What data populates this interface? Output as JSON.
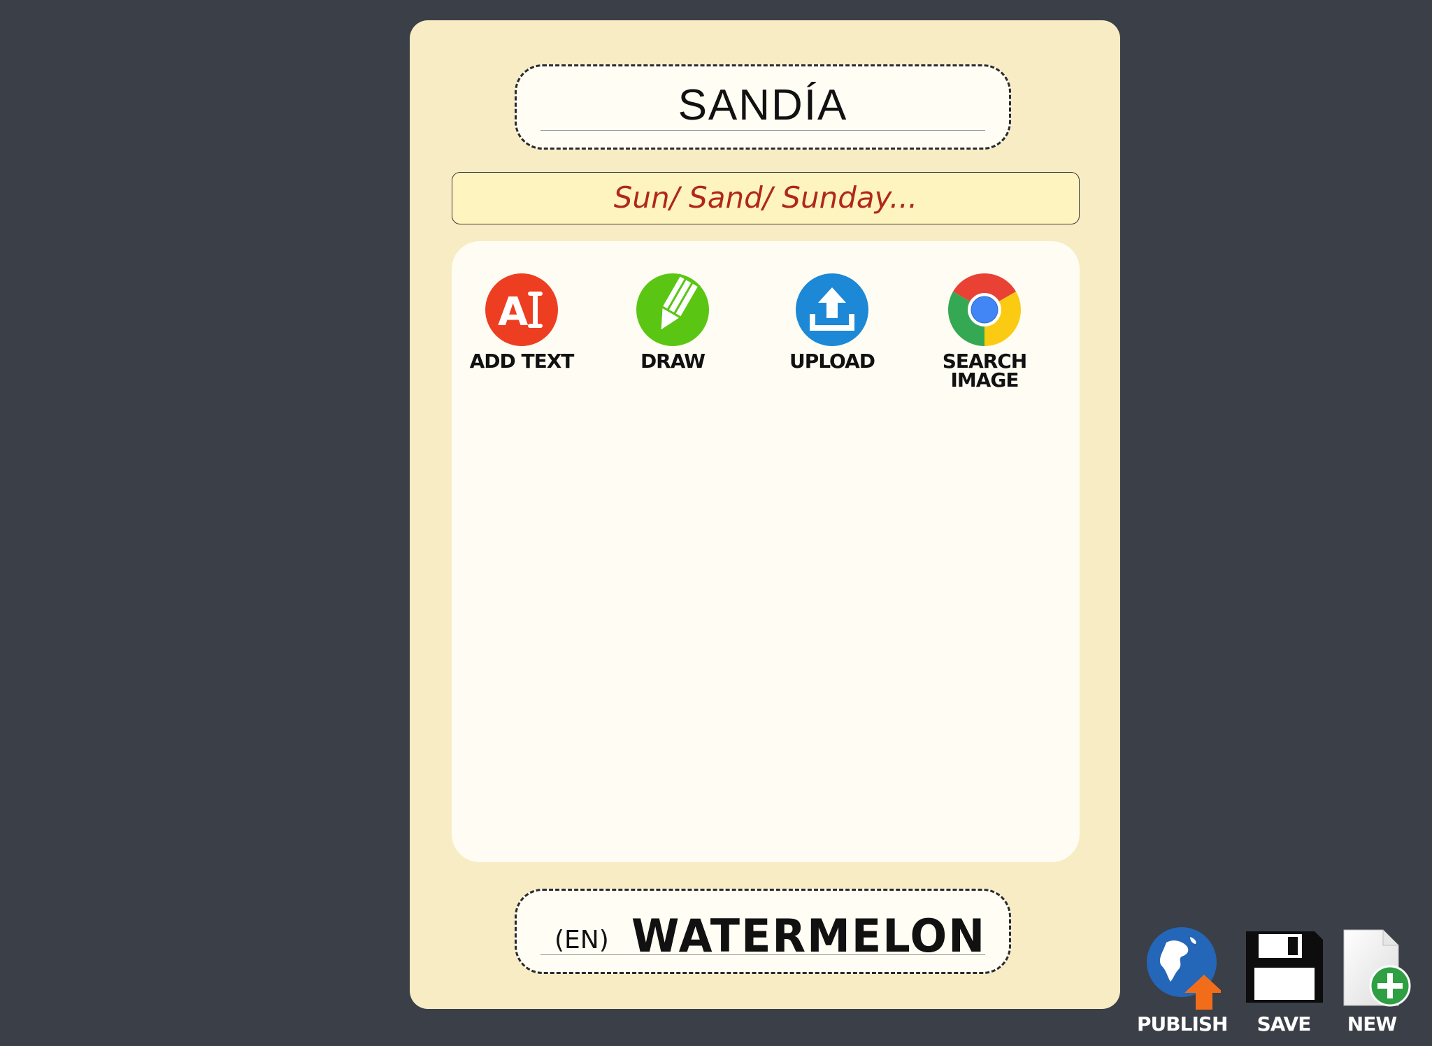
{
  "card": {
    "word": "SANDÍA",
    "hint": "Sun/ Sand/ Sunday...",
    "translation_lang": "(EN)",
    "translation": "WATERMELON"
  },
  "tools": [
    {
      "label": "ADD TEXT",
      "icon": "add-text-icon",
      "color": "#ee3e22"
    },
    {
      "label": "DRAW",
      "icon": "pencil-icon",
      "color": "#5ac613"
    },
    {
      "label": "UPLOAD",
      "icon": "upload-icon",
      "color": "#1c88d6"
    },
    {
      "label": "SEARCH\nIMAGE",
      "icon": "chrome-icon",
      "color": "#e94235"
    }
  ],
  "actions": {
    "publish": "PUBLISH",
    "save": "SAVE",
    "new": "NEW"
  }
}
